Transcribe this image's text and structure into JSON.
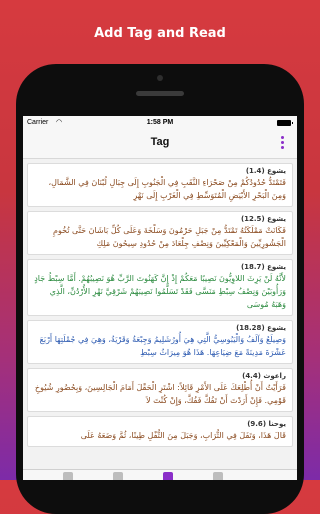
{
  "promo": {
    "title": "Add Tag and Read"
  },
  "status": {
    "carrier": "Carrier",
    "wifi_icon": "wifi-icon",
    "time": "1:58 PM"
  },
  "nav": {
    "title": "Tag",
    "more_icon": "more-vertical-icon"
  },
  "colors": {
    "accent": "#8b2fc9",
    "verse_text": "#8a4a1f",
    "highlight_green": "#2a8a3e",
    "highlight_blue": "#2b59b0"
  },
  "cards": [
    {
      "ref": "يشوع (1.4)",
      "verse": "فَتَمْتَدُّ حُدُودُكُمْ مِنْ صَحْرَاءِ النَّقَبِ فِي الْجَنُوبِ إِلَى جِبَالِ لُبْنَانَ فِي الشَّمَالِ، وَمِنَ الْبَحْرِ الأَبْيَضِ الْمُتَوَسِّطِ فِي الْغَرْبِ إِلَى نَهْرِ"
    },
    {
      "ref": "يشوع (12.5)",
      "verse": "فَكَانَتْ مَمْلَكَتُهُ تَمْتَدُّ مِنْ جَبَلِ حَرْمُونَ وَسَلْخَةَ وَعَلَى كُلِّ بَاشَانَ حَتَّى تُخُومِ الْجَشُورِيِّينَ وَالْمَعْكِيِّينَ وَنِصْفِ جِلْعَادَ مِنْ حُدُودِ سِيحُونَ مَلِكِ"
    },
    {
      "ref": "يشوع (18.7)",
      "verse": "لأَنَّهُ لَنْ يَرِثَ اللاوِيُّونَ نَصِيبًا مَعَكُمْ إِذْ إِنَّ كَهَنُوتَ الرَّبِّ هُوَ نَصِيبُهُمْ. أَمَّا سِبْطُ جَادٍ وَرَأُوبَيْنَ وَنِصْفُ سِبْطِ مَنَسَّى فَقَدْ تَسَلَّمُوا نَصِيبَهُمْ شَرْقِيَّ نَهْرِ الأُرْدُنِّ، الَّذِي وَهَبَهُ مُوسَى"
    },
    {
      "ref": "يشوع (18.28)",
      "verse": "وَصِيلَعُ وَآلَفُ وَالْيَبُوسِيُّ الَّتِي هِيَ أُورُشَلِيمُ وَجِبْعَةُ وَقَرْيَةُ، وَهِيَ فِي جُمْلَتِهَا أَرْبَعَ عَشْرَةَ مَدِينَةً مَعَ ضِيَاعِهَا. هَذَا هُوَ مِيرَاثُ سِبْطِ"
    },
    {
      "ref": "راعوث (4.4)",
      "verse": "فَرَأَيْتُ أَنْ أُطْلِعَكَ عَلَى الأَمْرِ قَائِلاً: اشْتَرِ الْحَقْلَ أَمَامَ الْجَالِسِينَ، وَبِحُضُورِ شُيُوخِ قَوْمِي. فَإِنْ أَرَدْتَ أَنْ تَفُكَّ فَفُكَّ، وَإِنْ كُنْتَ لاَ"
    },
    {
      "ref": "يوحنا (9.6)",
      "verse": "قَالَ هَذَا، وَتَفَلَ فِي التُّرَابِ، وَجَبَلَ مِنَ التُّفْلِ طِينًا، ثُمَّ وَضَعَهُ عَلَى"
    }
  ]
}
